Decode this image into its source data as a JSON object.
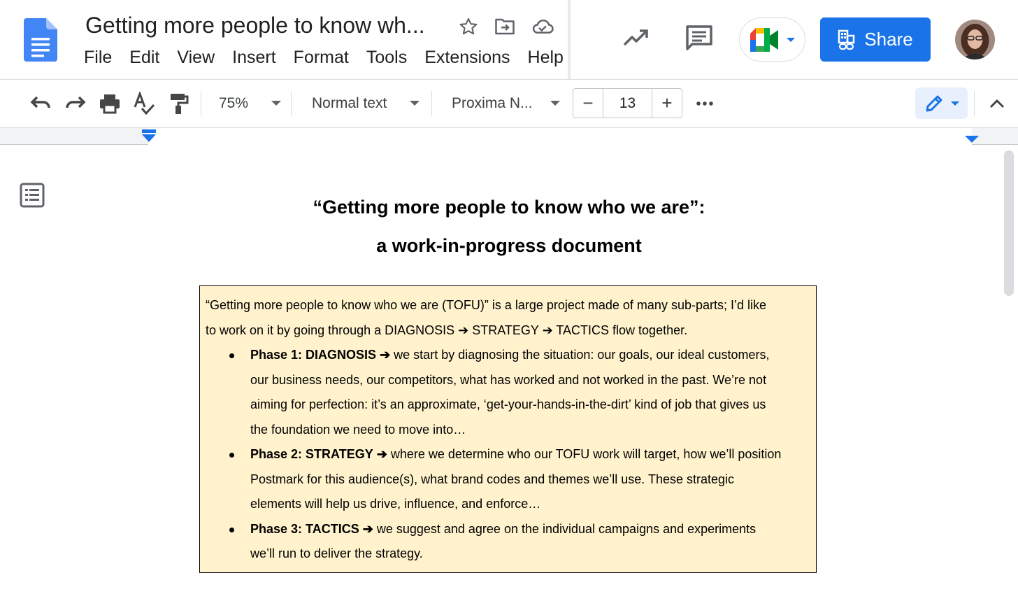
{
  "header": {
    "doc_title": "Getting more people to know wh...",
    "menu": [
      "File",
      "Edit",
      "View",
      "Insert",
      "Format",
      "Tools",
      "Extensions",
      "Help"
    ],
    "share_label": "Share"
  },
  "toolbar": {
    "zoom": "75%",
    "style": "Normal text",
    "font": "Proxima N...",
    "font_size": "13",
    "minus": "−",
    "plus": "+"
  },
  "document": {
    "heading_line1": "“Getting more people to know who we are”:",
    "heading_line2": "a work-in-progress document",
    "intro_line1": "“Getting more people to know who we are (TOFU)” is a large project made of many sub-parts; I’d like",
    "intro_line2": "to work on it by going through a DIAGNOSIS ➔  STRATEGY ➔ TACTICS flow together.",
    "phases": [
      {
        "label": "Phase 1: DIAGNOSIS",
        "arrow": "➔",
        "lines": [
          " we start by diagnosing the situation: our goals, our ideal customers,",
          "our business needs, our competitors, what has worked and not worked in the past. We’re not",
          "aiming for perfection: it’s an approximate, ‘get-your-hands-in-the-dirt’ kind of job that gives us",
          "the foundation we need to move into…"
        ]
      },
      {
        "label": "Phase 2: STRATEGY",
        "arrow": "➔",
        "lines": [
          " where we determine who our TOFU work will target, how we’ll position",
          "Postmark for this audience(s), what brand codes and themes we’ll use. These strategic",
          "elements will help us drive, influence, and enforce…"
        ]
      },
      {
        "label": "Phase 3: TACTICS",
        "arrow": "➔",
        "lines": [
          " we suggest and agree on the individual campaigns and experiments",
          "we’ll run to deliver the strategy."
        ]
      }
    ]
  },
  "colors": {
    "accent": "#1a73e8",
    "callout_bg": "#fff2cc",
    "docs_blue": "#4285f4"
  },
  "icons": [
    "docs-logo",
    "star-icon",
    "move-to-folder-icon",
    "cloud-saved-icon",
    "activity-trend-icon",
    "comments-icon",
    "meet-icon",
    "share-lock-icon",
    "avatar",
    "undo-icon",
    "redo-icon",
    "print-icon",
    "spellcheck-icon",
    "paint-format-icon",
    "more-icon",
    "pencil-icon",
    "collapse-icon",
    "outline-icon"
  ]
}
